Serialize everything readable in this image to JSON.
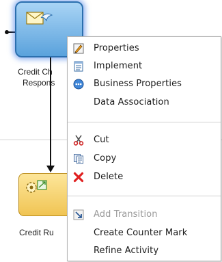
{
  "diagram": {
    "task1_label_line1": "Credit Ch",
    "task1_label_line2": "Respons",
    "task2_label": "Credit Ru"
  },
  "context_menu": {
    "groups": [
      [
        {
          "label": "Properties",
          "icon": "properties-icon"
        },
        {
          "label": "Implement",
          "icon": "implement-icon"
        },
        {
          "label": "Business Properties",
          "icon": "business-properties-icon"
        },
        {
          "label": "Data Association",
          "icon": ""
        }
      ],
      [
        {
          "label": "Cut",
          "icon": "cut-icon"
        },
        {
          "label": "Copy",
          "icon": "copy-icon"
        },
        {
          "label": "Delete",
          "icon": "delete-icon"
        }
      ],
      [
        {
          "label": "Add Transition",
          "icon": "add-transition-icon",
          "disabled": true
        },
        {
          "label": "Create Counter Mark",
          "icon": ""
        },
        {
          "label": "Refine Activity",
          "icon": ""
        }
      ]
    ]
  },
  "colors": {
    "task1_fill": "#5aa2dc",
    "task1_glow": "#3c78e6",
    "task2_fill": "#f0c453",
    "delete_red": "#e02020"
  }
}
